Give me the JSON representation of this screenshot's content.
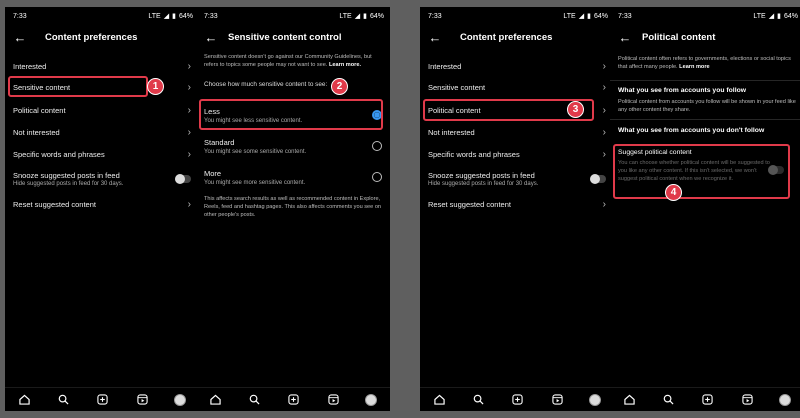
{
  "status": {
    "time": "7:33",
    "network": "LTE",
    "battery": "64%"
  },
  "colors": {
    "accent": "#3897f0",
    "highlight": "#e03a4a",
    "background": "#000000"
  },
  "screen1": {
    "title": "Content preferences",
    "items": [
      {
        "label": "Interested"
      },
      {
        "label": "Sensitive content"
      },
      {
        "label": "Political content"
      },
      {
        "label": "Not interested"
      },
      {
        "label": "Specific words and phrases"
      },
      {
        "label": "Snooze suggested posts in feed",
        "sub": "Hide suggested posts in feed for 30 days."
      },
      {
        "label": "Reset suggested content"
      }
    ]
  },
  "screen2": {
    "title": "Sensitive content control",
    "intro_text": "Sensitive content doesn't go against our Community Guidelines, but refers to topics some people may not want to see.",
    "learn_more": "Learn more.",
    "prompt": "Choose how much sensitive content to see:",
    "options": [
      {
        "label": "Less",
        "desc": "You might see less sensitive content."
      },
      {
        "label": "Standard",
        "desc": "You might see some sensitive content."
      },
      {
        "label": "More",
        "desc": "You might see more sensitive content."
      }
    ],
    "footer": "This affects search results as well as recommended content in Explore, Reels, feed and hashtag pages. This also affects comments you see on other people's posts."
  },
  "screen4": {
    "title": "Political content",
    "intro_text": "Political content often refers to governments, elections or social topics that affect many people.",
    "learn_more": "Learn more",
    "sec1_title": "What you see from accounts you follow",
    "sec1_text": "Political content from accounts you follow will be shown in your feed like any other content they share.",
    "sec2_title": "What you see from accounts you don't follow",
    "suggest_title": "Suggest political content",
    "suggest_text": "You can choose whether political content will be suggested to you like any other content. If this isn't selected, we won't suggest political content when we recognize it."
  },
  "badges": [
    "1",
    "2",
    "3",
    "4"
  ],
  "icons": {
    "back": "back-arrow-icon",
    "chevron": "chevron-right-icon",
    "home": "home-icon",
    "search": "search-icon",
    "create": "create-icon",
    "reels": "reels-icon",
    "profile": "avatar"
  }
}
